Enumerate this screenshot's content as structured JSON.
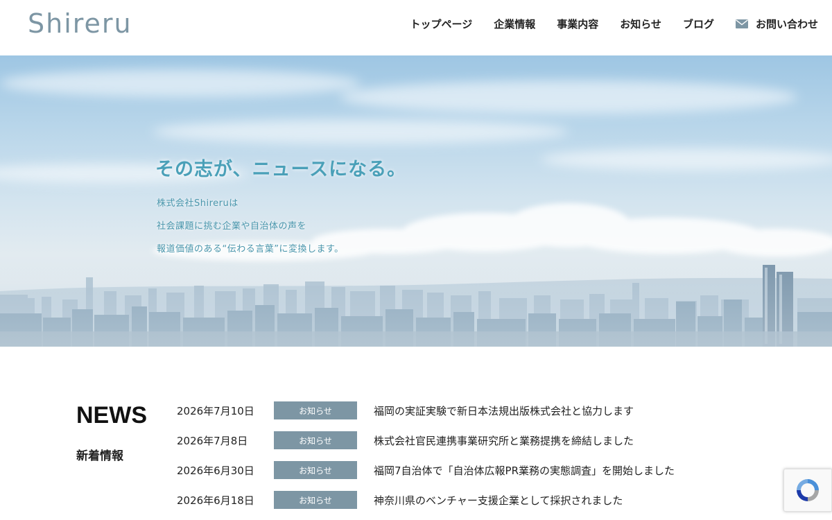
{
  "header": {
    "logo": "Shireru",
    "nav": [
      {
        "label": "トップページ"
      },
      {
        "label": "企業情報"
      },
      {
        "label": "事業内容"
      },
      {
        "label": "お知らせ"
      },
      {
        "label": "ブログ"
      },
      {
        "label": "お問い合わせ",
        "icon": "mail-icon"
      }
    ]
  },
  "hero": {
    "title": "その志が、ニュースになる。",
    "lines": [
      "株式会社Shireruは",
      "社会課題に挑む企業や自治体の声を",
      "報道価値のある“伝わる言葉”に変換します。"
    ]
  },
  "news": {
    "heading": "NEWS",
    "subheading": "新着情報",
    "items": [
      {
        "date": "2026年7月10日",
        "category": "お知らせ",
        "title": "福岡の実証実験で新日本法規出版株式会社と協力します"
      },
      {
        "date": "2026年7月8日",
        "category": "お知らせ",
        "title": "株式会社官民連携事業研究所と業務提携を締結しました"
      },
      {
        "date": "2026年6月30日",
        "category": "お知らせ",
        "title": "福岡7自治体で「自治体広報PR業務の実態調査」を開始しました"
      },
      {
        "date": "2026年6月18日",
        "category": "お知らせ",
        "title": "神奈川県のベンチャー支援企業として採択されました"
      }
    ]
  },
  "colors": {
    "accent": "#7d96a4",
    "hero_text": "#4aa0b8"
  },
  "widgets": {
    "recaptcha_icon": "recaptcha-icon"
  }
}
